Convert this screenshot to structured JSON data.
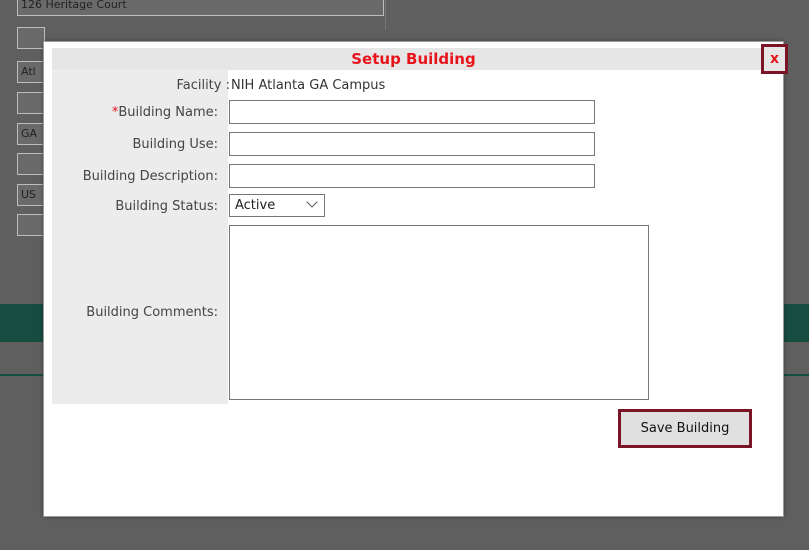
{
  "background": {
    "address_line": "126 Heritage Court",
    "city_fragment": "Atl",
    "state_fragment": "GA",
    "country_fragment": "US"
  },
  "dialog": {
    "title": "Setup Building",
    "close_label": "x",
    "facility_label": "Facility :",
    "facility_value": "NIH Atlanta GA Campus",
    "required_marker": "*",
    "building_name_label": "Building Name:",
    "building_name_value": "",
    "building_use_label": "Building Use:",
    "building_use_value": "",
    "building_description_label": "Building Description:",
    "building_description_value": "",
    "building_status_label": "Building Status:",
    "building_status_value": "Active",
    "building_comments_label": "Building Comments:",
    "building_comments_value": "",
    "save_label": "Save Building"
  },
  "colors": {
    "title": "#e8141c",
    "required": "#e8141c",
    "accent_border": "#7b1427",
    "background_band": "#0f4a3e"
  },
  "icons": {
    "close": "close-icon",
    "dropdown": "chevron-down-icon"
  }
}
